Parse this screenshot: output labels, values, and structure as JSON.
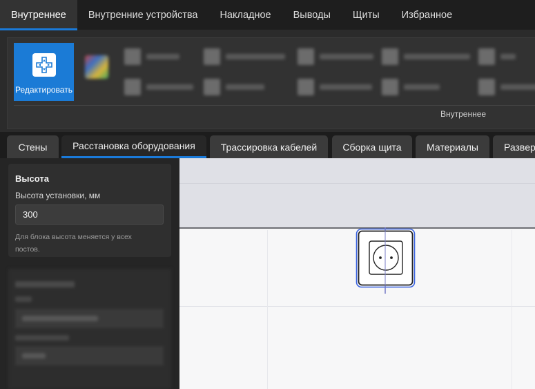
{
  "top_tabs": [
    {
      "label": "Внутреннее",
      "active": true
    },
    {
      "label": "Внутренние устройства",
      "active": false
    },
    {
      "label": "Накладное",
      "active": false
    },
    {
      "label": "Выводы",
      "active": false
    },
    {
      "label": "Щиты",
      "active": false
    },
    {
      "label": "Избранное",
      "active": false
    }
  ],
  "ribbon": {
    "edit_label": "Редактировать",
    "group_label": "Внутреннее"
  },
  "sub_tabs": [
    {
      "label": "Стены",
      "active": false
    },
    {
      "label": "Расстановка оборудования",
      "active": true
    },
    {
      "label": "Трассировка кабелей",
      "active": false
    },
    {
      "label": "Сборка щита",
      "active": false
    },
    {
      "label": "Материалы",
      "active": false
    },
    {
      "label": "Развер",
      "active": false
    }
  ],
  "height_panel": {
    "title": "Высота",
    "field_label": "Высота установки, мм",
    "value": "300",
    "hint": "Для блока высота меняется у всех постов."
  },
  "colors": {
    "accent": "#1b7bd6",
    "selection": "#2e63e0"
  },
  "icons": {
    "edit": "move-cross-icon",
    "canvas_item": "socket-icon"
  }
}
